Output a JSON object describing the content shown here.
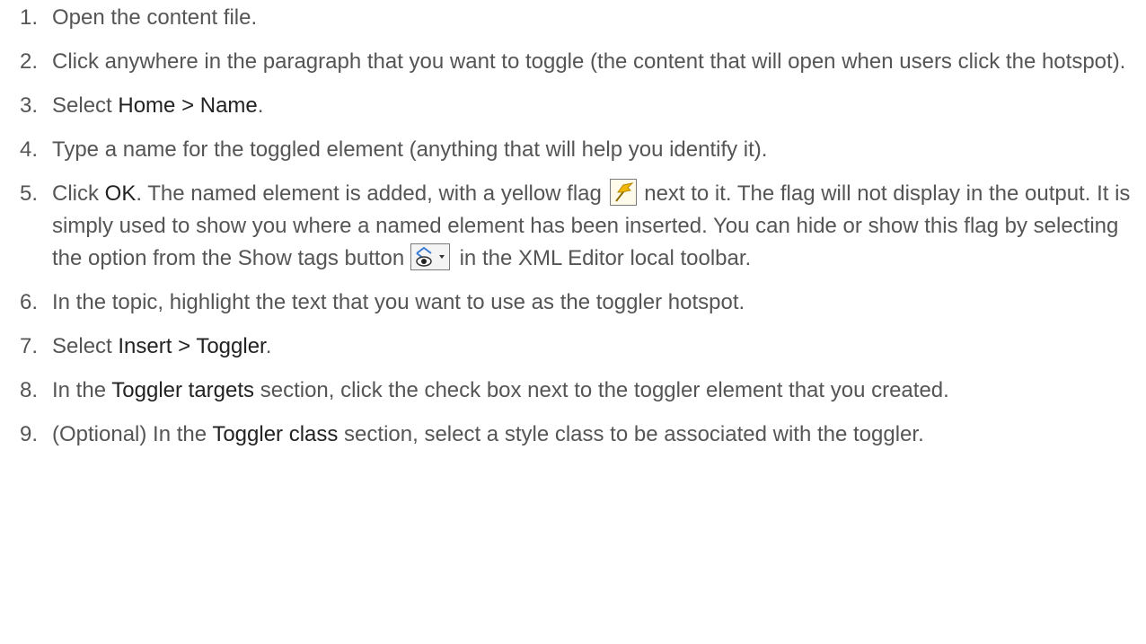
{
  "steps": [
    {
      "num": "1.",
      "text": "Open the content file."
    },
    {
      "num": "2.",
      "text": "Click anywhere in the paragraph that you want to toggle (the content that will open when users click the hotspot)."
    },
    {
      "num": "3.",
      "pre": "Select ",
      "ui": "Home > Name",
      "post": "."
    },
    {
      "num": "4.",
      "text": "Type a name for the toggled element (anything that will help you identify it)."
    },
    {
      "num": "5.",
      "pre": "Click ",
      "ui": "OK",
      "mid": ". The named element is added, with a yellow flag ",
      "post": " next to it. The flag will not display in the output. It is simply used to show you where a named element has been inserted. You can hide or show this flag by selecting the option from the Show tags button ",
      "end": " in the XML Editor local toolbar."
    },
    {
      "num": "6.",
      "text": "In the topic, highlight the text that you want to use as the toggler hotspot."
    },
    {
      "num": "7.",
      "pre": "Select ",
      "ui": "Insert > Toggler",
      "post": "."
    },
    {
      "num": "8.",
      "pre": "In the ",
      "ui": "Toggler targets",
      "post": " section, click the check box next to the toggler element that you created."
    },
    {
      "num": "9.",
      "pre": "(Optional) In the ",
      "ui": "Toggler class",
      "post": " section, select a style class to be associated with the toggler."
    }
  ],
  "icons": {
    "flag": "yellow-flag-icon",
    "show_tags": "show-tags-icon"
  },
  "colors": {
    "text": "#555555",
    "ui_text": "#222222",
    "flag": "#f2b705"
  }
}
